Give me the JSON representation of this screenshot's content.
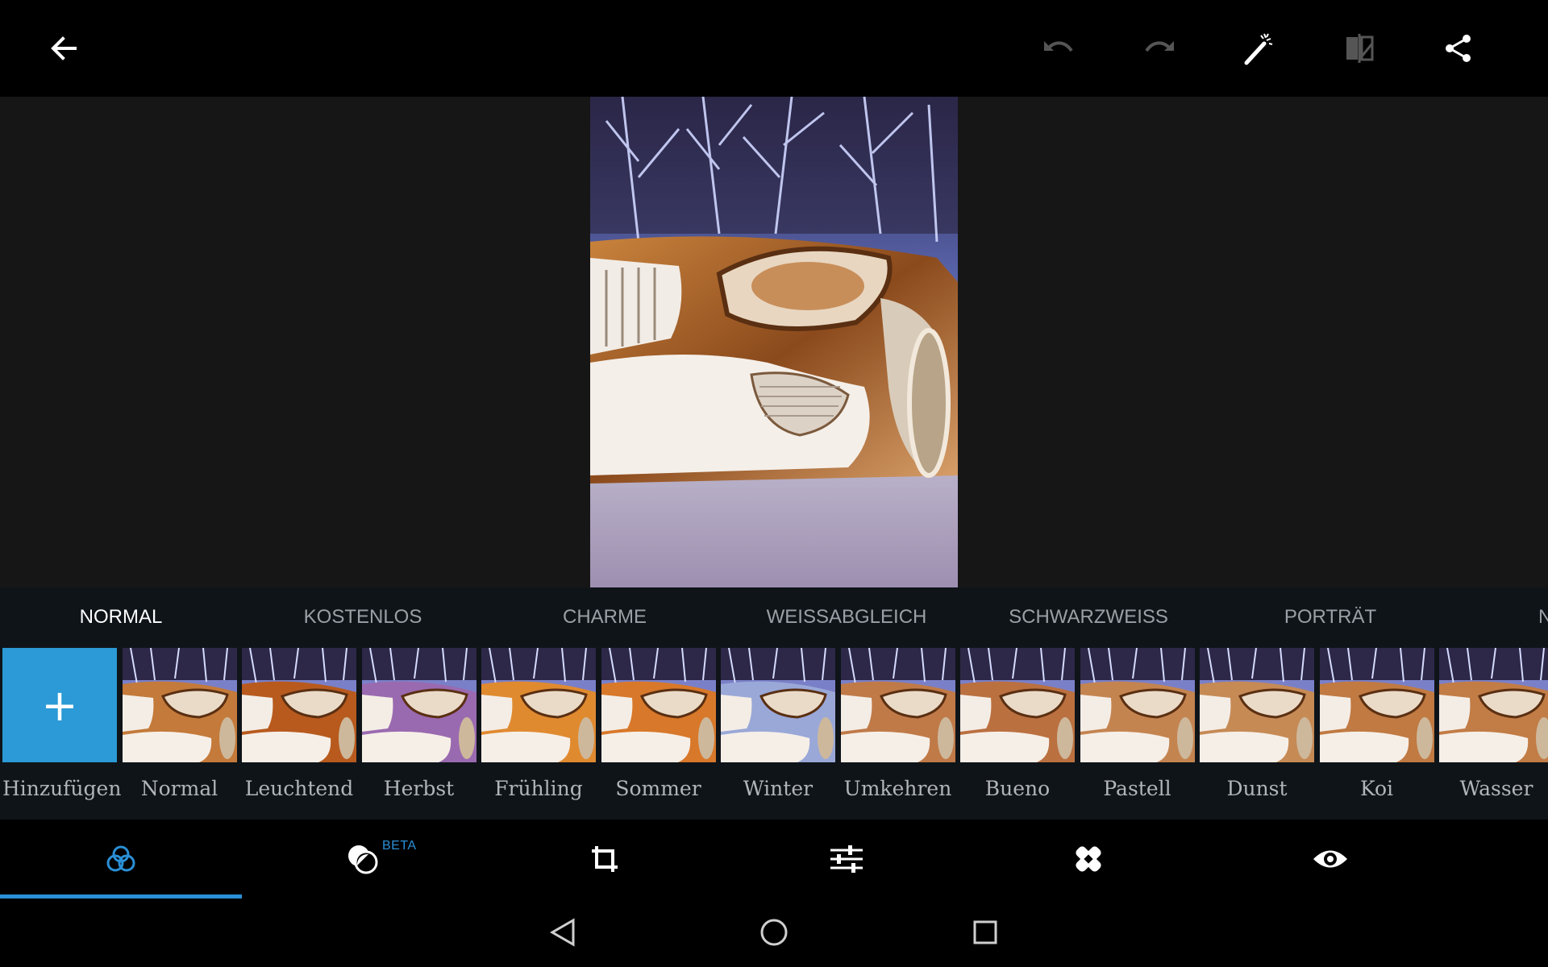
{
  "toolbar": {
    "back": "back-arrow-icon",
    "undo": "undo-icon",
    "redo": "redo-icon",
    "auto_fix": "magic-wand-icon",
    "compare": "compare-icon",
    "share": "share-icon"
  },
  "categories": [
    {
      "label": "NORMAL",
      "active": true
    },
    {
      "label": "KOSTENLOS"
    },
    {
      "label": "CHARME"
    },
    {
      "label": "WEISSABGLEICH"
    },
    {
      "label": "SCHWARZWEISS"
    },
    {
      "label": "PORTRÄT"
    },
    {
      "label": "N"
    }
  ],
  "filters": {
    "add_symbol": "+",
    "items": [
      {
        "label": "Hinzufügen"
      },
      {
        "label": "Normal"
      },
      {
        "label": "Leuchtend"
      },
      {
        "label": "Herbst"
      },
      {
        "label": "Frühling"
      },
      {
        "label": "Sommer"
      },
      {
        "label": "Winter"
      },
      {
        "label": "Umkehren"
      },
      {
        "label": "Bueno"
      },
      {
        "label": "Pastell"
      },
      {
        "label": "Dunst"
      },
      {
        "label": "Koi"
      },
      {
        "label": "Wasser"
      }
    ]
  },
  "tools": {
    "items": [
      "filters-icon",
      "blend-icon",
      "crop-icon",
      "adjustments-icon",
      "healing-icon",
      "eye-icon"
    ],
    "beta_label": "BETA",
    "active_index": 0
  },
  "colors": {
    "accent": "#2a8fd6",
    "add_tile": "#2b9ad6",
    "strip_bg": "#0f1419",
    "canvas_bg": "#161616"
  }
}
